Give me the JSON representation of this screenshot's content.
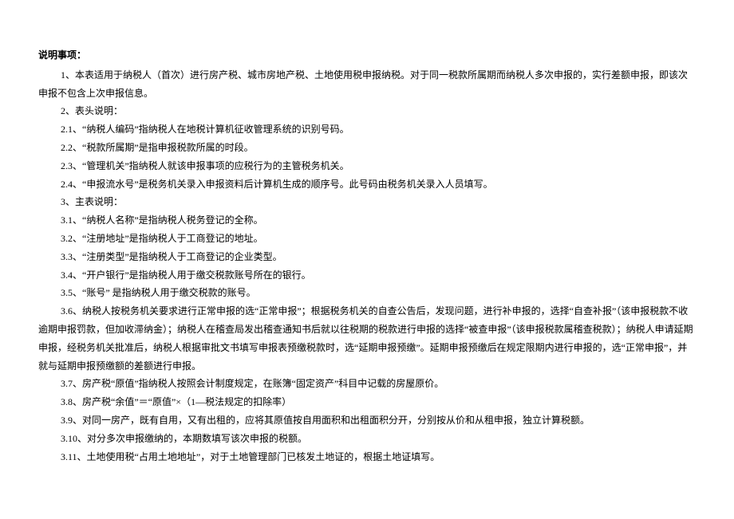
{
  "heading": "说明事项：",
  "items": [
    "1、本表适用于纳税人（首次）进行房产税、城市房地产税、土地使用税申报纳税。对于同一税款所属期而纳税人多次申报的，实行差额申报，即该次申报不包含上次申报信息。",
    "2、表头说明：",
    "2.1、“纳税人编码”指纳税人在地税计算机征收管理系统的识别号码。",
    "2.2、“税款所属期”是指申报税款所属的时段。",
    "2.3、“管理机关”指纳税人就该申报事项的应税行为的主管税务机关。",
    "2.4、“申报流水号”是税务机关录入申报资料后计算机生成的顺序号。此号码由税务机关录入人员填写。",
    "3、主表说明：",
    "3.1、“纳税人名称”是指纳税人税务登记的全称。",
    "3.2、“注册地址”是指纳税人于工商登记的地址。",
    "3.3、“注册类型”是指纳税人于工商登记的企业类型。",
    "3.4、“开户银行”是指纳税人用于缴交税款账号所在的银行。",
    "3.5、“账号” 是指纳税人用于缴交税款的账号。",
    "3.6、纳税人按税务机关要求进行正常申报的选“正常申报”；根据税务机关的自查公告后，发现问题，进行补申报的，选择“自查补报”（该申报税款不收逾期申报罚款，但加收滞纳金）；纳税人在稽查局发出稽查通知书后就以往税期的税款进行申报的选择“被查申报”（该申报税款属稽查税款）；纳税人申请延期申报，经税务机关批准后，纳税人根据审批文书填写申报表预缴税款时，选“延期申报预缴”。延期申报预缴后在规定限期内进行申报的，选“正常申报”，并就与延期申报预缴额的差额进行申报。",
    "3.7、房产税“原值”指纳税人按照会计制度规定，在账簿“固定资产”科目中记载的房屋原价。",
    "3.8、房产税“余值”＝“原值”×（1—税法规定的扣除率）",
    "3.9、对同一房产，既有自用，又有出租的，应将其原值按自用面积和出租面积分开，分别按从价和从租申报，独立计算税额。",
    "3.10、对分多次申报缴纳的，本期数填写该次申报的税额。",
    "3.11、土地使用税“占用土地地址”，对于土地管理部门已核发土地证的，根据土地证填写。"
  ]
}
